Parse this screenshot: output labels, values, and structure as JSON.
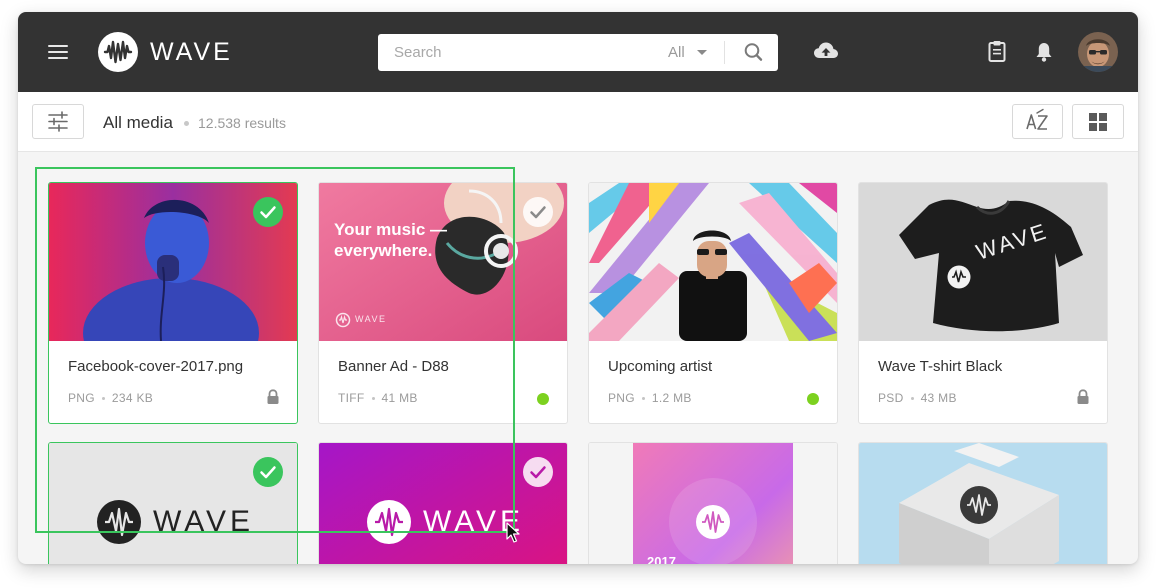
{
  "app": {
    "brand": "WAVE"
  },
  "search": {
    "placeholder": "Search",
    "filter": "All"
  },
  "toolbar": {
    "title": "All media",
    "count": "12.538 results",
    "sort_label": "A↓Z"
  },
  "colors": {
    "topbar": "#333333",
    "accent": "#3ac55d",
    "status_online": "#7cd11f"
  },
  "cards": [
    {
      "name": "Facebook-cover-2017.png",
      "format": "PNG",
      "size": "234 KB",
      "selected": true,
      "badge": "lock"
    },
    {
      "name": "Banner Ad - D88",
      "format": "TIFF",
      "size": "41 MB",
      "selected": false,
      "badge": "online",
      "thumb_line1": "Your music —",
      "thumb_line2": "everywhere.",
      "thumb_brand": "WAVE"
    },
    {
      "name": "Upcoming artist",
      "format": "PNG",
      "size": "1.2 MB",
      "selected": false,
      "badge": "online"
    },
    {
      "name": "Wave T-shirt Black",
      "format": "PSD",
      "size": "43 MB",
      "selected": false,
      "badge": "lock",
      "thumb_brand": "WAVE"
    },
    {
      "thumb_brand": "WAVE",
      "selected": true
    },
    {
      "thumb_brand": "WAVE",
      "selected": false
    },
    {
      "thumb_year": "2017"
    },
    {}
  ]
}
